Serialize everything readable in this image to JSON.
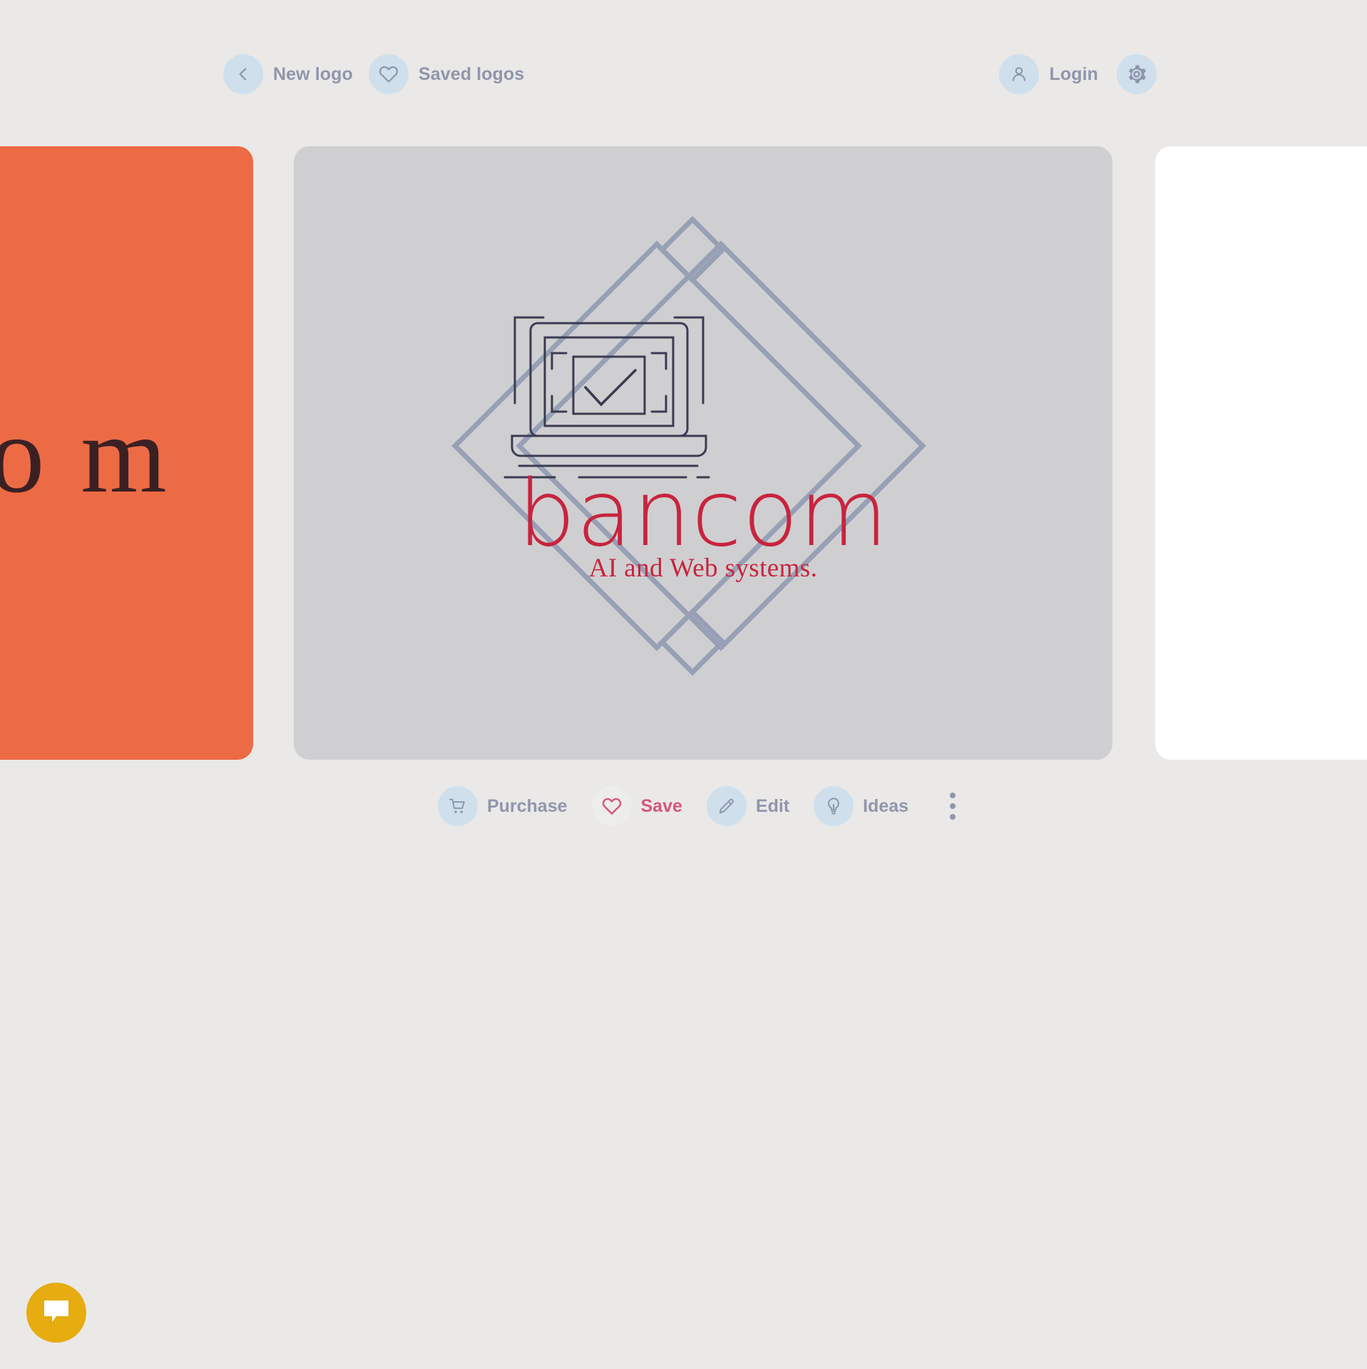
{
  "topnav": {
    "left_items": [
      {
        "label": "New logo",
        "icon": "chevron-left-icon"
      },
      {
        "label": "Saved logos",
        "icon": "heart-icon"
      }
    ],
    "right_items": [
      {
        "label": "Login",
        "icon": "user-icon"
      },
      {
        "label": "",
        "icon": "gear-icon"
      }
    ]
  },
  "carousel": {
    "prev_card": {
      "visible_text": "o m",
      "background_color": "#ec6b45",
      "text_color": "#3b2023"
    },
    "main_card": {
      "background_color": "#cfcfd1",
      "logo": {
        "brand": "bancom",
        "tagline": "AI and Web systems.",
        "brand_color": "#c8243e",
        "mark_color": "#97a0b5",
        "device_color": "#3b3b52",
        "icon": "laptop-checkmark-diamond-icon"
      }
    },
    "next_card": {
      "background_color": "#ffffff"
    }
  },
  "toolbar": {
    "actions": [
      {
        "label": "Purchase",
        "icon": "shopping-cart-icon",
        "state": "default"
      },
      {
        "label": "Save",
        "icon": "heart-icon",
        "state": "active"
      },
      {
        "label": "Edit",
        "icon": "pencil-icon",
        "state": "default"
      },
      {
        "label": "Ideas",
        "icon": "lightbulb-icon",
        "state": "default"
      }
    ],
    "more_menu": {
      "icon": "kebab-menu-icon"
    }
  },
  "chat": {
    "icon": "chat-bubble-icon",
    "color": "#e6ac10"
  },
  "theme": {
    "page_background": "#eae9e7",
    "icon_circle": "#cfe0ec",
    "muted_text": "#8f96ac",
    "accent_red": "#c8243e",
    "accent_pink": "#d3577d"
  }
}
